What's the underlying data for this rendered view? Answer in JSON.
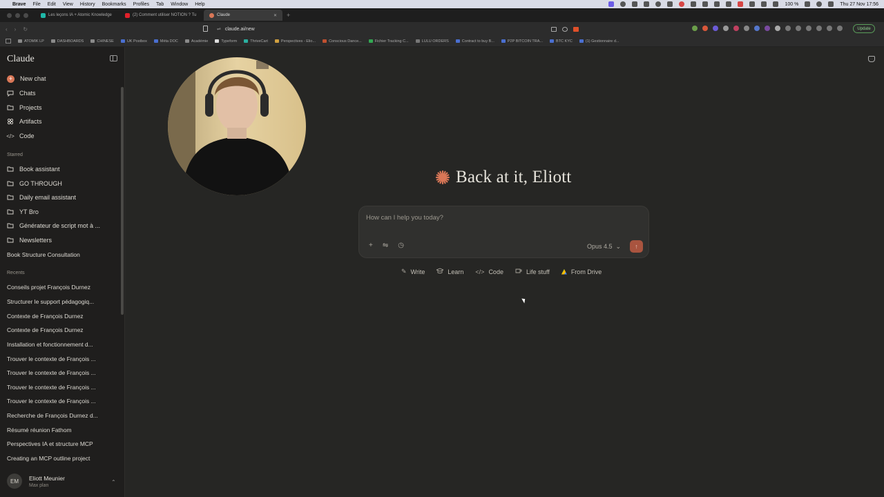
{
  "menubar": {
    "app": "Brave",
    "items": [
      "File",
      "Edit",
      "View",
      "History",
      "Bookmarks",
      "Profiles",
      "Tab",
      "Window",
      "Help"
    ],
    "battery": "100 %",
    "datetime": "Thu 27 Nov  17:56"
  },
  "tabs": [
    {
      "title": "Les leçons IA + Atomic Knowledge",
      "color": "#1fb8a8"
    },
    {
      "title": "(2) Comment utiliser NOTION ? Tu",
      "color": "#e0202a"
    },
    {
      "title": "Claude",
      "color": "#d97757",
      "close": "✕"
    }
  ],
  "new_tab": "+",
  "url": "claude.ai/new",
  "update_label": "Update",
  "bookmarks": [
    "ATOMIK LP",
    "DASHBOARDS",
    "CHINESE",
    "UK Postbox",
    "Méta DOC",
    "Académie",
    "Typeform",
    "ThriveCart",
    "Perspectives - Elio...",
    "Conscious Dance...",
    "Fichier Tracking C...",
    "LULU ORDERS",
    "Contract to buy B...",
    "P2P BITCOIN TRA...",
    "BTC KYC",
    "(1) Gestionnaire d..."
  ],
  "sidebar": {
    "brand": "Claude",
    "nav": [
      {
        "label": "New chat",
        "icon": "plus-icon"
      },
      {
        "label": "Chats",
        "icon": "chat-icon"
      },
      {
        "label": "Projects",
        "icon": "folder-icon"
      },
      {
        "label": "Artifacts",
        "icon": "artifacts-icon"
      },
      {
        "label": "Code",
        "icon": "code-icon"
      }
    ],
    "starred_label": "Starred",
    "starred": [
      "Book assistant",
      "GO THROUGH",
      "Daily email assistant",
      "YT Bro",
      "Générateur de script mot à ...",
      "Newsletters"
    ],
    "starred_chat": "Book Structure Consultation",
    "recents_label": "Recents",
    "recents": [
      "Conseils projet François Durnez",
      "Structurer le support pédagogiq...",
      "Contexte de François Durnez",
      "Contexte de François Durnez",
      "Installation et fonctionnement d...",
      "Trouver le contexte de François ...",
      "Trouver le contexte de François ...",
      "Trouver le contexte de François ...",
      "Trouver le contexte de François ...",
      "Recherche de François Durnez d...",
      "Résumé réunion Fathom",
      "Perspectives IA et structure MCP",
      "Creating an MCP outline project"
    ],
    "user": {
      "initials": "EM",
      "name": "Eliott Meunier",
      "plan": "Max plan"
    }
  },
  "main": {
    "greeting": "Back at it, Eliott",
    "composer": {
      "placeholder": "How can I help you today?",
      "model": "Opus 4.5"
    },
    "chips": [
      {
        "label": "Write",
        "icon": "pencil-icon"
      },
      {
        "label": "Learn",
        "icon": "graduation-cap-icon"
      },
      {
        "label": "Code",
        "icon": "code-icon"
      },
      {
        "label": "Life stuff",
        "icon": "coffee-icon"
      },
      {
        "label": "From Drive",
        "icon": "google-drive-icon"
      }
    ]
  },
  "colors": {
    "accent": "#d97757",
    "background": "#262624",
    "sidebar": "#1f1e1d",
    "composer": "#30302e"
  }
}
